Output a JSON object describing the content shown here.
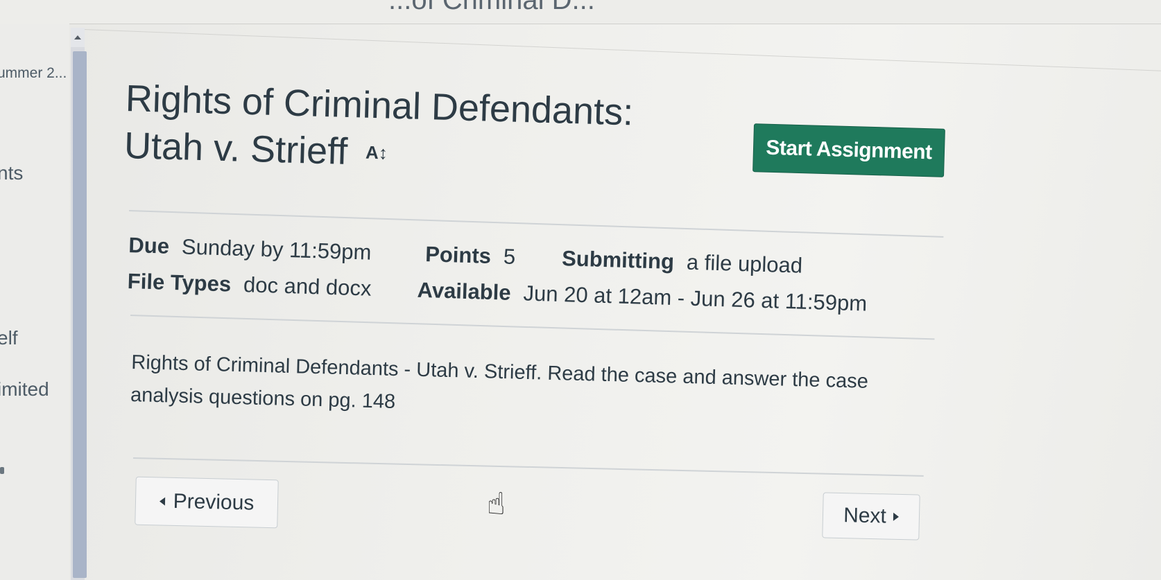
{
  "header": {
    "title": "...of Criminal D..."
  },
  "left_nav": {
    "items": [
      "ummer 2...",
      "nts",
      "elf",
      "imited"
    ]
  },
  "assignment": {
    "title_line1": "Rights of Criminal Defendants:",
    "title_line2": "Utah v. Strieff",
    "font_icon_label": "A↕",
    "start_button": "Start Assignment",
    "details": {
      "due_label": "Due",
      "due_value": "Sunday by 11:59pm",
      "points_label": "Points",
      "points_value": "5",
      "submitting_label": "Submitting",
      "submitting_value": "a file upload",
      "file_types_label": "File Types",
      "file_types_value": "doc and docx",
      "available_label": "Available",
      "available_value": "Jun 20 at 12am - Jun 26 at 11:59pm"
    },
    "description": "Rights of Criminal Defendants - Utah v. Strieff. Read the case and answer the case analysis questions on pg. 148"
  },
  "pager": {
    "previous": "Previous",
    "next": "Next"
  },
  "colors": {
    "accent": "#1f7a5c",
    "text": "#2d3b45",
    "scrollbar_thumb": "#a9b4c8"
  },
  "icons": {
    "cursor": "pointer-hand-icon",
    "scroll_up": "triangle-up-icon",
    "prev": "caret-left-icon",
    "next": "caret-right-icon"
  }
}
